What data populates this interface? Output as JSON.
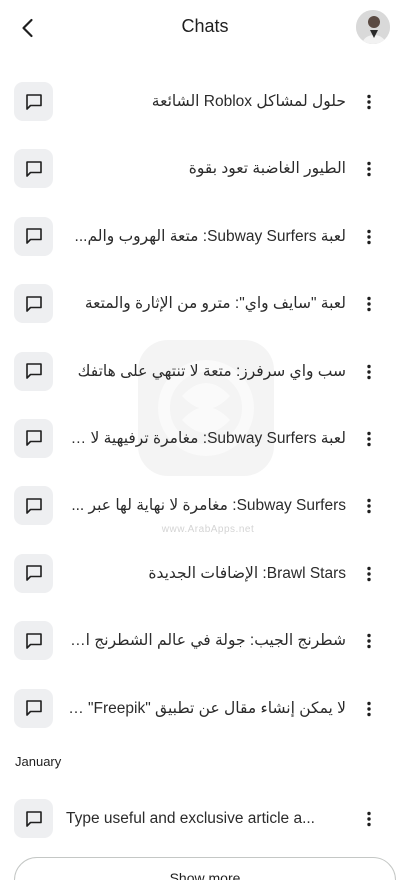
{
  "header": {
    "title": "Chats",
    "back_icon": "arrow-back-icon",
    "avatar_icon": "user-avatar"
  },
  "chats": [
    {
      "title": "حلول لمشاكل Roblox الشائعة"
    },
    {
      "title": "الطيور الغاضبة تعود بقوة"
    },
    {
      "title": "لعبة Subway Surfers: متعة الهروب والم..."
    },
    {
      "title": "لعبة \"سايف واي\": مترو من الإثارة والمتعة"
    },
    {
      "title": "سب واي سرفرز: متعة لا تنتهي على هاتفك"
    },
    {
      "title": "لعبة Subway Surfers: مغامرة ترفيهية لا ت..."
    },
    {
      "title": "Subway Surfers: مغامرة لا نهاية لها عبر ..."
    },
    {
      "title": "Brawl Stars: الإضافات الجديدة"
    },
    {
      "title": "شطرنج الجيب: جولة في عالم الشطرنج المصغر"
    },
    {
      "title": "لا يمكن إنشاء مقال عن تطبيق \"Freepik\" بال..."
    }
  ],
  "section": {
    "label": "January"
  },
  "january_chats": [
    {
      "title": "Type useful and exclusive article a..."
    }
  ],
  "show_more": {
    "label": "Show more"
  },
  "watermark": {
    "text": "www.ArabApps.net"
  },
  "colors": {
    "icon_box_bg": "#eeeff1",
    "text": "#1f1f1f",
    "border": "#c4c7c5"
  }
}
